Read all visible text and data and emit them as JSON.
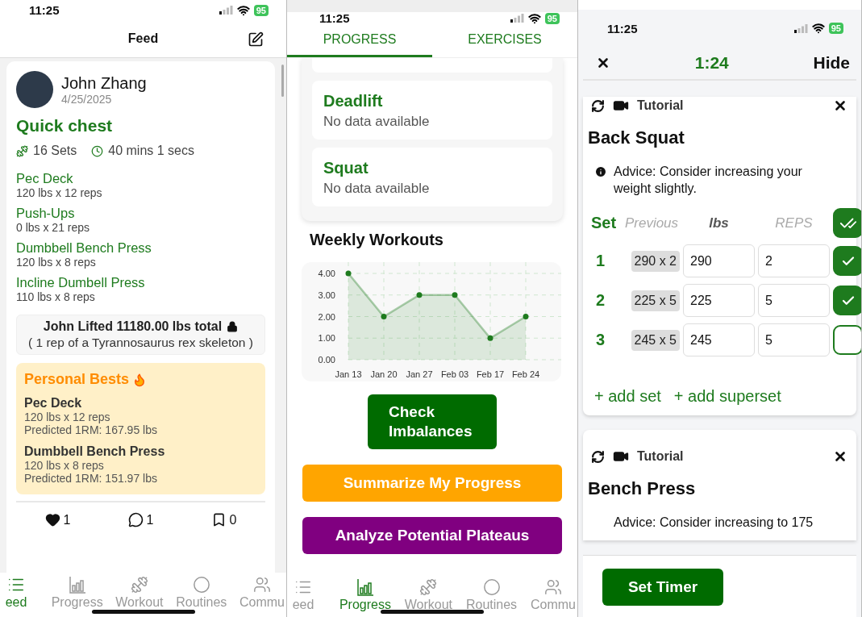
{
  "feed_screen": {
    "status_bar": {
      "time": "11:25",
      "battery": "95"
    },
    "header": {
      "title": "Feed"
    },
    "post": {
      "author": "John Zhang",
      "date": "4/25/2025",
      "workout_title": "Quick chest",
      "sets": "16 Sets",
      "duration": "40 mins 1 secs",
      "exercises": [
        {
          "name": "Pec Deck",
          "detail": "120 lbs x 12 reps"
        },
        {
          "name": "Push-Ups",
          "detail": "0 lbs x 21 reps"
        },
        {
          "name": "Dumbbell Bench Press",
          "detail": "120 lbs x 8 reps"
        },
        {
          "name": "Incline Dumbell Press",
          "detail": "110 lbs x 8 reps"
        }
      ],
      "total": {
        "headline": "John Lifted 11180.00 lbs total",
        "comparison": "( 1 rep of a Tyrannosaurus rex skeleton )"
      },
      "personal_bests": {
        "title": "Personal Bests",
        "items": [
          {
            "name": "Pec Deck",
            "detail": "120 lbs x 12 reps",
            "predicted": "Predicted 1RM: 167.95 lbs"
          },
          {
            "name": "Dumbbell Bench Press",
            "detail": "120 lbs x 8 reps",
            "predicted": "Predicted 1RM: 151.97 lbs"
          }
        ]
      },
      "actions": [
        {
          "kind": "like",
          "count": "1"
        },
        {
          "kind": "comment",
          "count": "1"
        },
        {
          "kind": "bookmark",
          "count": "0"
        }
      ]
    },
    "tab_bar": [
      {
        "kind": "feed",
        "label": "eed",
        "selected": true
      },
      {
        "kind": "progress",
        "label": "Progress",
        "selected": false
      },
      {
        "kind": "workout",
        "label": "Workout",
        "selected": false
      },
      {
        "kind": "routines",
        "label": "Routines",
        "selected": false
      },
      {
        "kind": "community",
        "label": "Commu",
        "selected": false
      }
    ]
  },
  "progress_screen": {
    "status_bar": {
      "time": "11:25",
      "battery": "95"
    },
    "tabs": [
      {
        "label": "PROGRESS",
        "selected": true
      },
      {
        "label": "EXERCISES",
        "selected": false
      }
    ],
    "exercise_cards": [
      {
        "name": "Deadlift",
        "note": "No data available"
      },
      {
        "name": "Squat",
        "note": "No data available"
      }
    ],
    "weekly_title": "Weekly Workouts",
    "chart_data": {
      "type": "area",
      "categories": [
        "Jan 13",
        "Jan 20",
        "Jan 27",
        "Feb 03",
        "Feb 17",
        "Feb 24"
      ],
      "series": [
        {
          "color": "#1e7b1e",
          "values": [
            4,
            2,
            3,
            3,
            1,
            2
          ]
        }
      ],
      "grid": true,
      "ylim": [
        0,
        4
      ],
      "yticks": [
        {
          "value": 0,
          "label": "0.00"
        },
        {
          "value": 1,
          "label": "1.00"
        },
        {
          "value": 2,
          "label": "2.00"
        },
        {
          "value": 3,
          "label": "3.00"
        },
        {
          "value": 4,
          "label": "4.00"
        }
      ]
    },
    "buttons": [
      {
        "kind": "imbalances",
        "label": "Check Imbalances"
      },
      {
        "kind": "summarize",
        "label": "Summarize My Progress"
      },
      {
        "kind": "plateaus",
        "label": "Analyze Potential Plateaus"
      }
    ],
    "tab_bar": [
      {
        "kind": "feed",
        "label": "eed",
        "selected": false
      },
      {
        "kind": "progress",
        "label": "Progress",
        "selected": true
      },
      {
        "kind": "workout",
        "label": "Workout",
        "selected": false
      },
      {
        "kind": "routines",
        "label": "Routines",
        "selected": false
      },
      {
        "kind": "community",
        "label": "Commu",
        "selected": false
      }
    ]
  },
  "workout_screen": {
    "status_bar": {
      "time": "11:25",
      "battery": "95"
    },
    "timer": "1:24",
    "hide": "Hide",
    "exercises": [
      {
        "tutorial": "Tutorial",
        "name": "Back Squat",
        "advice": "Advice: Consider increasing your weight slightly.",
        "columns": {
          "set": "Set",
          "previous": "Previous",
          "weight": "lbs",
          "reps": "REPS"
        },
        "all_done": true,
        "sets": [
          {
            "number": "1",
            "previous": "290 x 2",
            "weight": "290",
            "reps": "2",
            "done": true
          },
          {
            "number": "2",
            "previous": "225 x 5",
            "weight": "225",
            "reps": "5",
            "done": true
          },
          {
            "number": "3",
            "previous": "245 x 5",
            "weight": "245",
            "reps": "5",
            "done": false
          }
        ],
        "add_set": "+ add set",
        "add_superset": "+ add superset"
      },
      {
        "tutorial": "Tutorial",
        "name": "Bench Press",
        "advice": "Advice: Consider increasing to 175"
      }
    ],
    "set_timer": "Set Timer"
  }
}
